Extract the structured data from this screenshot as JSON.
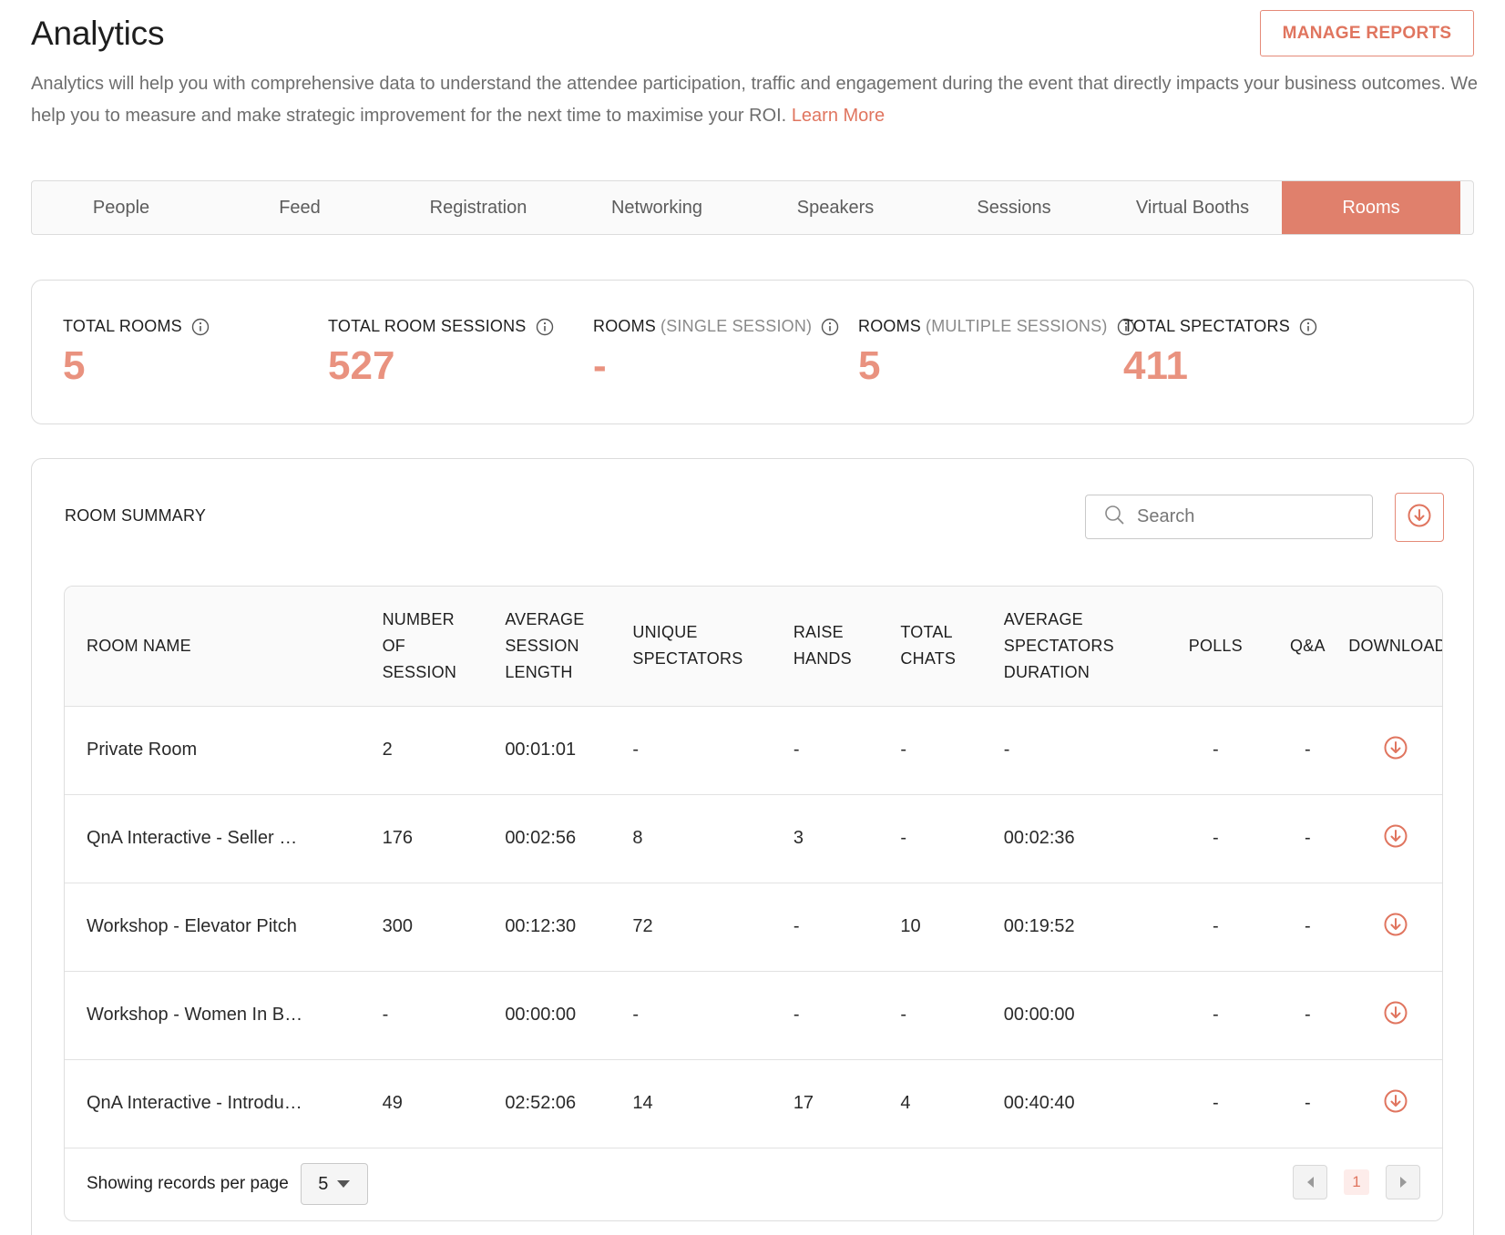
{
  "header": {
    "title": "Analytics",
    "manage_reports_label": "MANAGE REPORTS",
    "description": "Analytics will help you with comprehensive data to understand the attendee participation, traffic and engagement during the event that directly impacts your business outcomes. We help you to measure and make strategic improvement for the next time to maximise your ROI.",
    "learn_more_label": "Learn More"
  },
  "tabs": [
    {
      "label": "People"
    },
    {
      "label": "Feed"
    },
    {
      "label": "Registration"
    },
    {
      "label": "Networking"
    },
    {
      "label": "Speakers"
    },
    {
      "label": "Sessions"
    },
    {
      "label": "Virtual Booths"
    },
    {
      "label": "Rooms"
    }
  ],
  "active_tab": "Rooms",
  "stats": {
    "total_rooms": {
      "label": "TOTAL ROOMS",
      "value": "5"
    },
    "total_room_sessions": {
      "label": "TOTAL ROOM SESSIONS",
      "value": "527"
    },
    "rooms_single": {
      "label": "ROOMS",
      "sub": "(SINGLE SESSION)",
      "value": "-"
    },
    "rooms_multiple": {
      "label": "ROOMS",
      "sub": "(MULTIPLE SESSIONS)",
      "value": "5"
    },
    "total_spectators": {
      "label": "TOTAL SPECTATORS",
      "value": "411"
    }
  },
  "summary": {
    "title": "ROOM SUMMARY",
    "search_placeholder": "Search",
    "columns": {
      "room_name": "ROOM NAME",
      "number_of_session_1": "NUMBER",
      "number_of_session_2": "OF",
      "number_of_session_3": "SESSION",
      "avg_session_length_1": "AVERAGE",
      "avg_session_length_2": "SESSION",
      "avg_session_length_3": "LENGTH",
      "unique_spectators_1": "UNIQUE",
      "unique_spectators_2": "SPECTATORS",
      "raise_hands_1": "RAISE",
      "raise_hands_2": "HANDS",
      "total_chats_1": "TOTAL",
      "total_chats_2": "CHATS",
      "avg_spectators_duration_1": "AVERAGE",
      "avg_spectators_duration_2": "SPECTATORS",
      "avg_spectators_duration_3": "DURATION",
      "polls": "POLLS",
      "qa": "Q&A",
      "download": "DOWNLOAD"
    },
    "rows": [
      {
        "name": "Private Room",
        "sessions": "2",
        "avg_length": "00:01:01",
        "unique": "-",
        "raise": "-",
        "chats": "-",
        "avg_duration": "-",
        "polls": "-",
        "qa": "-"
      },
      {
        "name": "QnA Interactive - Seller …",
        "sessions": "176",
        "avg_length": "00:02:56",
        "unique": "8",
        "raise": "3",
        "chats": "-",
        "avg_duration": "00:02:36",
        "polls": "-",
        "qa": "-"
      },
      {
        "name": "Workshop - Elevator Pitch",
        "sessions": "300",
        "avg_length": "00:12:30",
        "unique": "72",
        "raise": "-",
        "chats": "10",
        "avg_duration": "00:19:52",
        "polls": "-",
        "qa": "-"
      },
      {
        "name": "Workshop - Women In B…",
        "sessions": "-",
        "avg_length": "00:00:00",
        "unique": "-",
        "raise": "-",
        "chats": "-",
        "avg_duration": "00:00:00",
        "polls": "-",
        "qa": "-"
      },
      {
        "name": "QnA Interactive - Introdu…",
        "sessions": "49",
        "avg_length": "02:52:06",
        "unique": "14",
        "raise": "17",
        "chats": "4",
        "avg_duration": "00:40:40",
        "polls": "-",
        "qa": "-"
      }
    ],
    "footer": {
      "per_page_label": "Showing records per page",
      "per_page_value": "5",
      "current_page": "1"
    }
  },
  "colors": {
    "accent": "#e0806c",
    "stat_value": "#e9927f"
  },
  "icons": {
    "info": "info-icon",
    "search": "search-icon",
    "download": "download-circle-icon",
    "caret": "caret-down-icon",
    "prev": "chevron-left-icon",
    "next": "chevron-right-icon"
  }
}
